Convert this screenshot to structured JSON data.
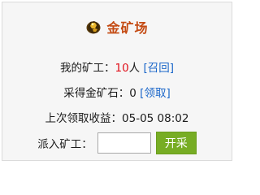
{
  "header": {
    "title": "金矿场",
    "icon": "gold-ore-icon"
  },
  "miners": {
    "label": "我的矿工：",
    "count": "10",
    "unit": "人",
    "recall_link": "[召回]"
  },
  "ore": {
    "label": "采得金矿石：",
    "count": "0",
    "collect_link": "[领取]"
  },
  "last_collect": {
    "label": "上次领取收益：",
    "time": "05-05 08:02"
  },
  "dispatch": {
    "label": "派入矿工：",
    "input_value": "",
    "button_label": "开采"
  },
  "colors": {
    "title": "#c44a12",
    "count_highlight": "#e0101a",
    "link": "#1a66c9",
    "button": "#77ad24"
  }
}
